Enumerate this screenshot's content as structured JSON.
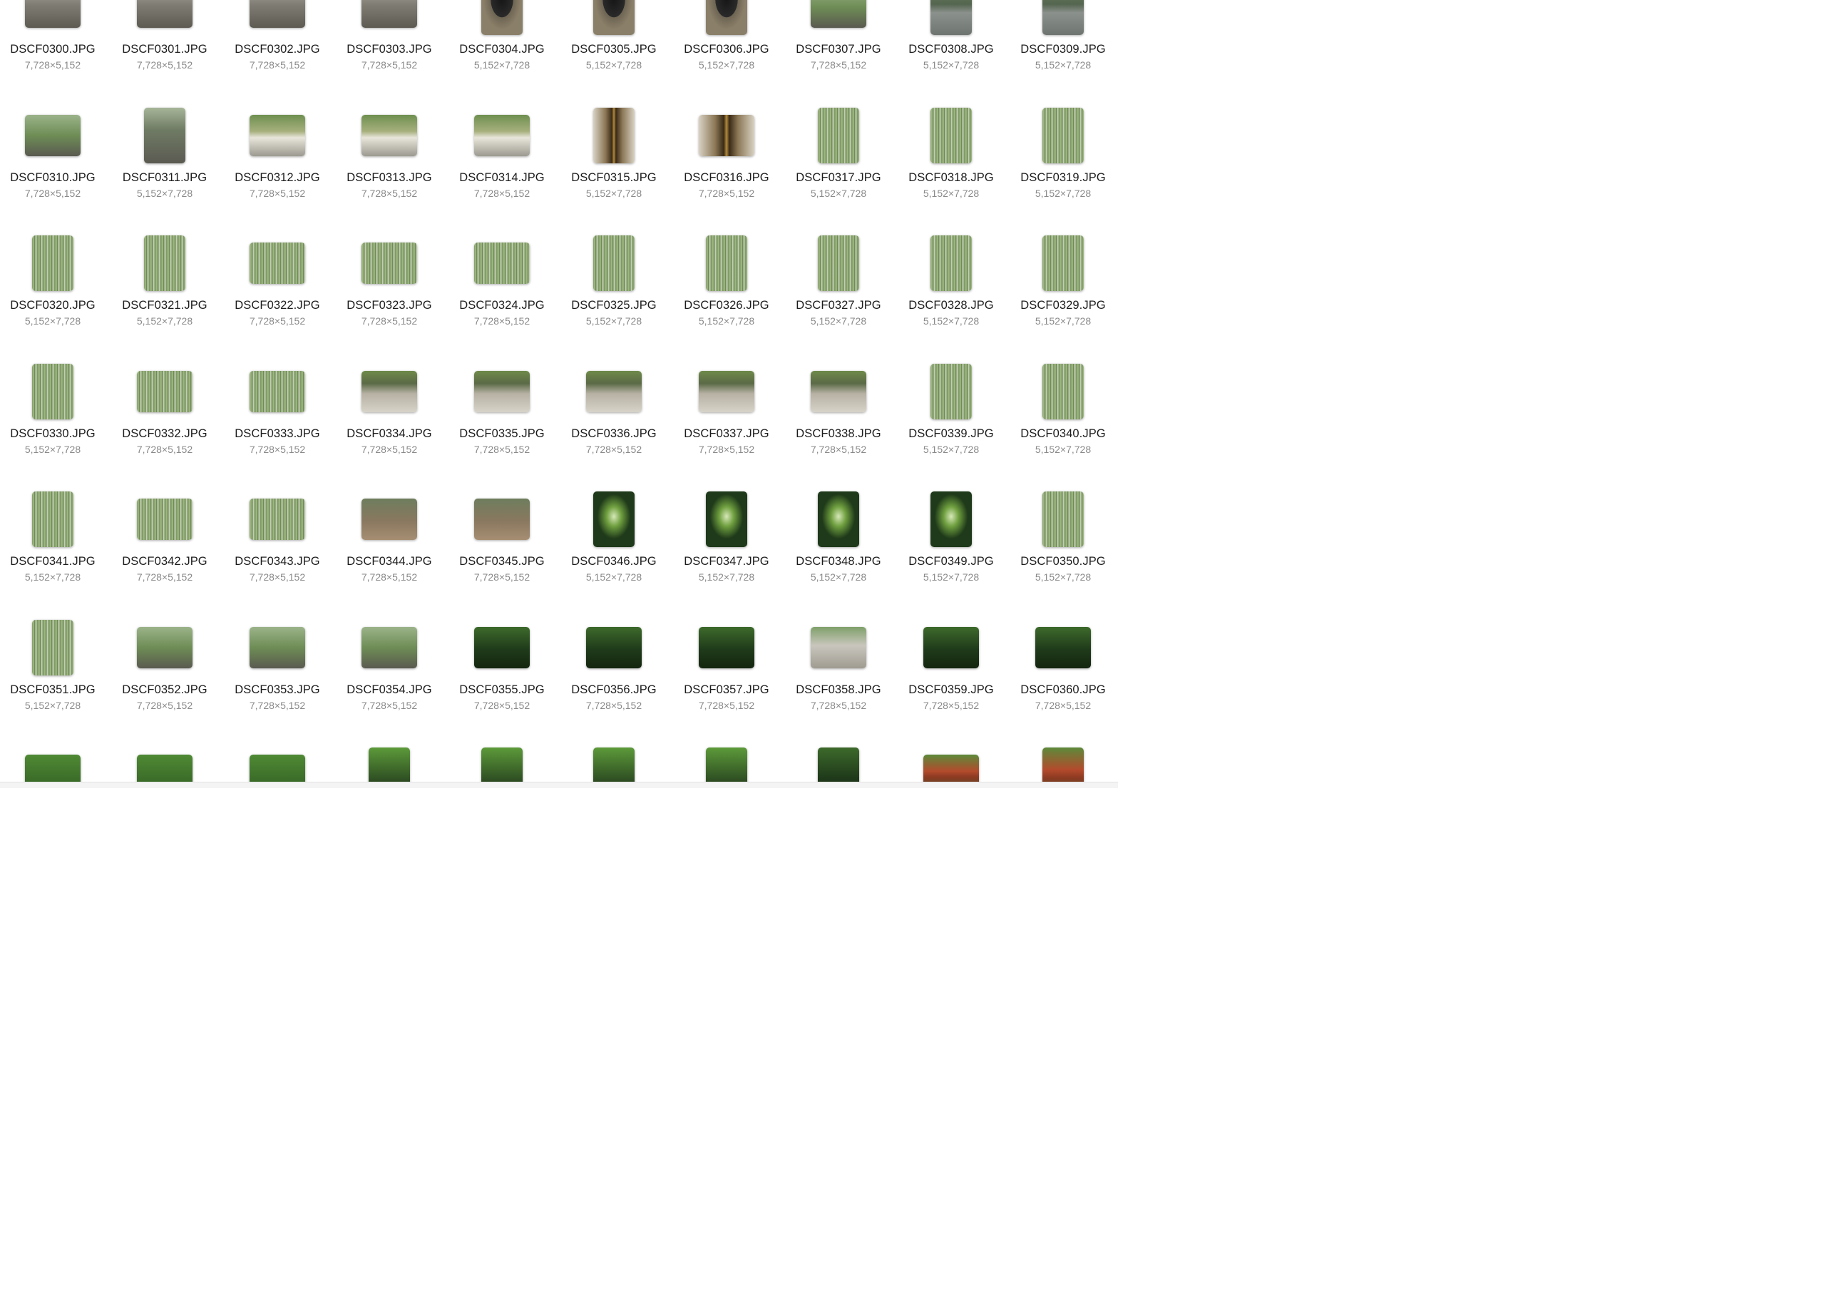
{
  "colors": {
    "filename_text": "#1c1c1c",
    "dimension_text": "#8a8a8a",
    "background": "#ffffff",
    "thumb_gray": "#7d7a72",
    "thumb_dark_green": "#1f3a1a",
    "thumb_bamboo": "#6f8f4e",
    "thumb_bright_green": "#5d9a3a",
    "thumb_red_torii": "#b34a2c"
  },
  "files": [
    {
      "name": "DSCF0300.JPG",
      "dims": "7,728×5,152",
      "scene": "stone"
    },
    {
      "name": "DSCF0301.JPG",
      "dims": "7,728×5,152",
      "scene": "stone"
    },
    {
      "name": "DSCF0302.JPG",
      "dims": "7,728×5,152",
      "scene": "stone"
    },
    {
      "name": "DSCF0303.JPG",
      "dims": "7,728×5,152",
      "scene": "stone"
    },
    {
      "name": "DSCF0304.JPG",
      "dims": "5,152×7,728",
      "scene": "bell"
    },
    {
      "name": "DSCF0305.JPG",
      "dims": "5,152×7,728",
      "scene": "bell"
    },
    {
      "name": "DSCF0306.JPG",
      "dims": "5,152×7,728",
      "scene": "bell"
    },
    {
      "name": "DSCF0307.JPG",
      "dims": "7,728×5,152",
      "scene": "garden"
    },
    {
      "name": "DSCF0308.JPG",
      "dims": "5,152×7,728",
      "scene": "pond"
    },
    {
      "name": "DSCF0309.JPG",
      "dims": "5,152×7,728",
      "scene": "pond"
    },
    {
      "name": "DSCF0310.JPG",
      "dims": "7,728×5,152",
      "scene": "garden"
    },
    {
      "name": "DSCF0311.JPG",
      "dims": "5,152×7,728",
      "scene": "pagoda"
    },
    {
      "name": "DSCF0312.JPG",
      "dims": "7,728×5,152",
      "scene": "temple"
    },
    {
      "name": "DSCF0313.JPG",
      "dims": "7,728×5,152",
      "scene": "temple"
    },
    {
      "name": "DSCF0314.JPG",
      "dims": "7,728×5,152",
      "scene": "temple"
    },
    {
      "name": "DSCF0315.JPG",
      "dims": "5,152×7,728",
      "scene": "shrine"
    },
    {
      "name": "DSCF0316.JPG",
      "dims": "7,728×5,152",
      "scene": "shrine"
    },
    {
      "name": "DSCF0317.JPG",
      "dims": "5,152×7,728",
      "scene": "bamboo"
    },
    {
      "name": "DSCF0318.JPG",
      "dims": "5,152×7,728",
      "scene": "bamboo"
    },
    {
      "name": "DSCF0319.JPG",
      "dims": "5,152×7,728",
      "scene": "bamboo"
    },
    {
      "name": "DSCF0320.JPG",
      "dims": "5,152×7,728",
      "scene": "bamboo"
    },
    {
      "name": "DSCF0321.JPG",
      "dims": "5,152×7,728",
      "scene": "bamboo"
    },
    {
      "name": "DSCF0322.JPG",
      "dims": "7,728×5,152",
      "scene": "bamboo"
    },
    {
      "name": "DSCF0323.JPG",
      "dims": "7,728×5,152",
      "scene": "bamboo"
    },
    {
      "name": "DSCF0324.JPG",
      "dims": "7,728×5,152",
      "scene": "bamboo"
    },
    {
      "name": "DSCF0325.JPG",
      "dims": "5,152×7,728",
      "scene": "bamboo"
    },
    {
      "name": "DSCF0326.JPG",
      "dims": "5,152×7,728",
      "scene": "bamboo"
    },
    {
      "name": "DSCF0327.JPG",
      "dims": "5,152×7,728",
      "scene": "bamboo"
    },
    {
      "name": "DSCF0328.JPG",
      "dims": "5,152×7,728",
      "scene": "bamboo"
    },
    {
      "name": "DSCF0329.JPG",
      "dims": "5,152×7,728",
      "scene": "bamboo"
    },
    {
      "name": "DSCF0330.JPG",
      "dims": "5,152×7,728",
      "scene": "bamboo"
    },
    {
      "name": "DSCF0332.JPG",
      "dims": "7,728×5,152",
      "scene": "bamboo"
    },
    {
      "name": "DSCF0333.JPG",
      "dims": "7,728×5,152",
      "scene": "bamboo"
    },
    {
      "name": "DSCF0334.JPG",
      "dims": "7,728×5,152",
      "scene": "lantern"
    },
    {
      "name": "DSCF0335.JPG",
      "dims": "7,728×5,152",
      "scene": "lantern"
    },
    {
      "name": "DSCF0336.JPG",
      "dims": "7,728×5,152",
      "scene": "lantern"
    },
    {
      "name": "DSCF0337.JPG",
      "dims": "7,728×5,152",
      "scene": "lantern"
    },
    {
      "name": "DSCF0338.JPG",
      "dims": "7,728×5,152",
      "scene": "lantern"
    },
    {
      "name": "DSCF0339.JPG",
      "dims": "5,152×7,728",
      "scene": "bamboo"
    },
    {
      "name": "DSCF0340.JPG",
      "dims": "5,152×7,728",
      "scene": "bamboo"
    },
    {
      "name": "DSCF0341.JPG",
      "dims": "5,152×7,728",
      "scene": "bamboo"
    },
    {
      "name": "DSCF0342.JPG",
      "dims": "7,728×5,152",
      "scene": "bamboo"
    },
    {
      "name": "DSCF0343.JPG",
      "dims": "7,728×5,152",
      "scene": "bamboo"
    },
    {
      "name": "DSCF0344.JPG",
      "dims": "7,728×5,152",
      "scene": "forest-floor"
    },
    {
      "name": "DSCF0345.JPG",
      "dims": "7,728×5,152",
      "scene": "forest-floor"
    },
    {
      "name": "DSCF0346.JPG",
      "dims": "5,152×7,728",
      "scene": "canopy"
    },
    {
      "name": "DSCF0347.JPG",
      "dims": "5,152×7,728",
      "scene": "canopy"
    },
    {
      "name": "DSCF0348.JPG",
      "dims": "5,152×7,728",
      "scene": "canopy"
    },
    {
      "name": "DSCF0349.JPG",
      "dims": "5,152×7,728",
      "scene": "canopy"
    },
    {
      "name": "DSCF0350.JPG",
      "dims": "5,152×7,728",
      "scene": "bamboo"
    },
    {
      "name": "DSCF0351.JPG",
      "dims": "5,152×7,728",
      "scene": "bamboo"
    },
    {
      "name": "DSCF0352.JPG",
      "dims": "7,728×5,152",
      "scene": "garden"
    },
    {
      "name": "DSCF0353.JPG",
      "dims": "7,728×5,152",
      "scene": "garden"
    },
    {
      "name": "DSCF0354.JPG",
      "dims": "7,728×5,152",
      "scene": "garden"
    },
    {
      "name": "DSCF0355.JPG",
      "dims": "7,728×5,152",
      "scene": "dark-forest"
    },
    {
      "name": "DSCF0356.JPG",
      "dims": "7,728×5,152",
      "scene": "dark-forest"
    },
    {
      "name": "DSCF0357.JPG",
      "dims": "7,728×5,152",
      "scene": "dark-forest"
    },
    {
      "name": "DSCF0358.JPG",
      "dims": "7,728×5,152",
      "scene": "torii-stone"
    },
    {
      "name": "DSCF0359.JPG",
      "dims": "7,728×5,152",
      "scene": "dark-forest"
    },
    {
      "name": "DSCF0360.JPG",
      "dims": "7,728×5,152",
      "scene": "dark-forest"
    },
    {
      "name": "",
      "dims": "",
      "scene": "trees",
      "orientation": "landscape"
    },
    {
      "name": "",
      "dims": "",
      "scene": "trees",
      "orientation": "landscape"
    },
    {
      "name": "",
      "dims": "",
      "scene": "trees",
      "orientation": "landscape"
    },
    {
      "name": "",
      "dims": "",
      "scene": "path",
      "orientation": "portrait"
    },
    {
      "name": "",
      "dims": "",
      "scene": "path",
      "orientation": "portrait"
    },
    {
      "name": "",
      "dims": "",
      "scene": "path",
      "orientation": "portrait"
    },
    {
      "name": "",
      "dims": "",
      "scene": "path",
      "orientation": "portrait"
    },
    {
      "name": "",
      "dims": "",
      "scene": "dark-forest",
      "orientation": "portrait"
    },
    {
      "name": "",
      "dims": "",
      "scene": "torii-red",
      "orientation": "landscape"
    },
    {
      "name": "",
      "dims": "",
      "scene": "torii-red",
      "orientation": "portrait"
    }
  ]
}
